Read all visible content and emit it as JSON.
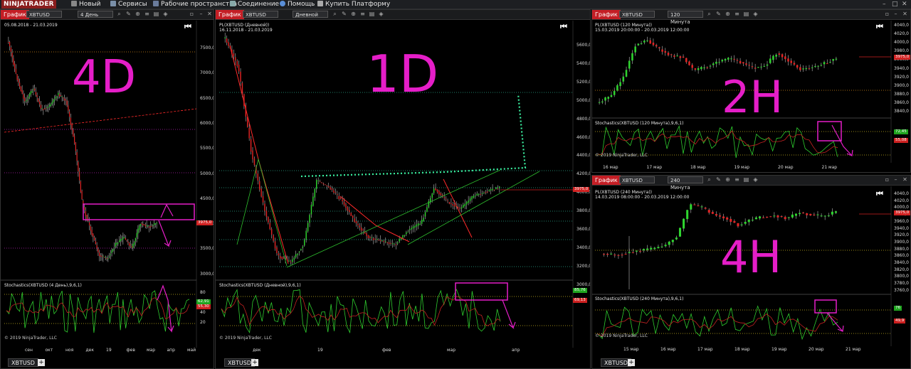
{
  "app": {
    "logo": "NINJATRADER"
  },
  "menu": [
    {
      "label": "Новый",
      "icon": "new-icon"
    },
    {
      "label": "Сервисы",
      "icon": "tools-icon"
    },
    {
      "label": "Рабочие пространства",
      "icon": "workspace-icon"
    },
    {
      "label": "Соединение",
      "icon": "connection-icon"
    },
    {
      "label": "Помощь",
      "icon": "help-icon"
    },
    {
      "label": "Купить Платформу",
      "icon": "cart-icon"
    }
  ],
  "panels": {
    "p4d": {
      "tab": "График",
      "instrument": "XBTUSD",
      "interval": "4 День",
      "range": "05.08.2018 - 21.03.2019",
      "tag": "4D",
      "y_labels": [
        "7500,0",
        "7000,0",
        "6500,0",
        "6000,0",
        "5500,0",
        "5000,0",
        "4500,0",
        "4000,0",
        "3500,0",
        "3000,0"
      ],
      "price_badge": "3975,0",
      "x_labels": [
        "сен",
        "окт",
        "ноя",
        "дек",
        "19",
        "фев",
        "мар",
        "апр",
        "май"
      ],
      "stoch_title": "Stochastics(XBTUSD (4 День),9,6,1)",
      "stoch_y": [
        "80",
        "60",
        "40",
        "20"
      ],
      "stoch_badges": [
        "62,91",
        "55,30"
      ],
      "copyright": "© 2019 NinjaTrader, LLC",
      "bottom_tab": "XBTUSD"
    },
    "p1d": {
      "tab": "График",
      "instrument": "XBTUSD",
      "interval": "Дневной",
      "title": "PL(XBTUSD (Дневной))",
      "range": "16.11.2018 - 21.03.2019",
      "tag": "1D",
      "y_labels": [
        "5600,0",
        "5400,0",
        "5200,0",
        "5000,0",
        "4800,0",
        "4600,0",
        "4400,0",
        "4200,0",
        "4000,0",
        "3800,0",
        "3600,0",
        "3400,0",
        "3200,0",
        "3000,0"
      ],
      "price_badge": "3975,0",
      "x_labels": [
        "дек",
        "19",
        "фев",
        "мар",
        "апр"
      ],
      "stoch_title": "Stochastics(XBTUSD (Дневной),9,6,1)",
      "stoch_y": [
        "80",
        "60",
        "40",
        "20"
      ],
      "stoch_badges": [
        "85,76",
        "69,13"
      ],
      "copyright": "© 2019 NinjaTrader, LLC",
      "bottom_tab": "XBTUSD"
    },
    "p2h": {
      "tab": "График",
      "instrument": "XBTUSD",
      "interval": "120 Минута",
      "title": "PL(XBTUSD (120 Минута))",
      "range": "15.03.2019 20:00:00 - 20.03.2019 12:00:00",
      "tag": "2H",
      "y_labels": [
        "4040,0",
        "4020,0",
        "4000,0",
        "3980,0",
        "3960,0",
        "3940,0",
        "3920,0",
        "3900,0",
        "3880,0",
        "3860,0",
        "3840,0"
      ],
      "price_badge": "3975,0",
      "x_labels": [
        "16 мар",
        "17 мар",
        "18 мар",
        "19 мар",
        "20 мар",
        "21 мар"
      ],
      "stoch_title": "Stochastics(XBTUSD (120 Минута),9,6,1)",
      "stoch_badges": [
        "72,45",
        "55,08"
      ],
      "copyright": "© 2019 NinjaTrader, LLC"
    },
    "p4h": {
      "tab": "График",
      "instrument": "XBTUSD",
      "interval": "240 Минута",
      "title": "PL(XBTUSD (240 Минута))",
      "range": "14.03.2019 08:00:00 - 20.03.2019 12:00:00",
      "tag": "4H",
      "y_labels": [
        "4040,0",
        "4020,0",
        "4000,0",
        "3980,0",
        "3960,0",
        "3940,0",
        "3920,0",
        "3900,0",
        "3880,0",
        "3860,0",
        "3840,0",
        "3820,0",
        "3800,0",
        "3780,0",
        "3760,0"
      ],
      "price_badge": "3975,0",
      "x_labels": [
        "15 мар",
        "16 мар",
        "17 мар",
        "18 мар",
        "19 мар",
        "20 мар",
        "21 мар"
      ],
      "stoch_title": "Stochastics(XBTUSD (240 Минута),9,6,1)",
      "stoch_badges": [
        "76",
        "49,9"
      ],
      "copyright": "© 2019 NinjaTrader, LLC",
      "bottom_tab": "XBTUSD"
    }
  },
  "colors": {
    "bull": "#2fd52f",
    "bear": "#e02424",
    "annot": "#e51ec8",
    "trend": "#ff2a2a",
    "green_line": "#3ccf3c",
    "dotted": "#3af0a0"
  }
}
